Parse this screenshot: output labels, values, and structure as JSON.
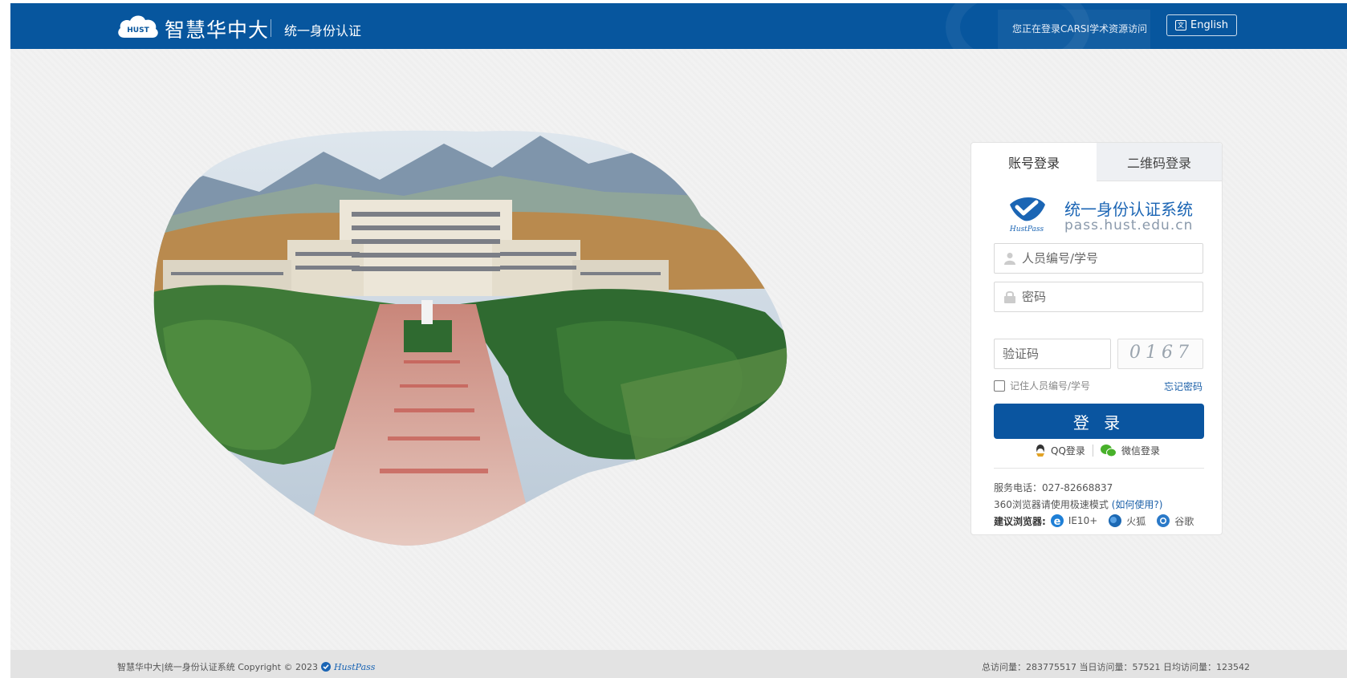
{
  "header": {
    "logo_badge": "HUST",
    "title": "智慧华中大",
    "subtitle": "统一身份认证",
    "carsi_notice": "您正在登录CARSI学术资源访问",
    "language_button": "English",
    "language_icon": "translate-icon"
  },
  "login": {
    "tabs": [
      {
        "label": "账号登录",
        "active": true
      },
      {
        "label": "二维码登录",
        "active": false
      }
    ],
    "brand_name": "统一身份认证系统",
    "brand_url": "pass.hust.edu.cn",
    "brand_badge": "HustPass",
    "username_placeholder": "人员编号/学号",
    "password_placeholder": "密码",
    "captcha_placeholder": "验证码",
    "captcha_text": "0167",
    "remember_label": "记住人员编号/学号",
    "forgot_link": "忘记密码",
    "login_button": "登 录",
    "social": [
      {
        "label": "QQ登录",
        "icon": "qq-icon",
        "color": "#e2a326"
      },
      {
        "label": "微信登录",
        "icon": "wechat-icon",
        "color": "#48b12a"
      }
    ],
    "service_phone": "服务电话：027-82668837",
    "speed_mode_note": "360浏览器请使用极速模式",
    "speed_mode_link": "(如何使用?)",
    "browsers_label": "建议浏览器:",
    "browsers": [
      {
        "name": "IE10+",
        "icon": "ie-icon"
      },
      {
        "name": "火狐",
        "icon": "firefox-icon"
      },
      {
        "name": "谷歌",
        "icon": "chrome-icon"
      }
    ]
  },
  "footer": {
    "copyright": "智慧华中大|统一身份认证系统 Copyright © 2023",
    "copyright_badge": "HustPass",
    "stats": "总访问量：283775517 当日访问量：57521 日均访问量：123542"
  },
  "colors": {
    "header_bg": "#07569e",
    "primary_button": "#0a55a0",
    "link": "#1a5fa8",
    "footer_bg": "#e3e3e3"
  }
}
